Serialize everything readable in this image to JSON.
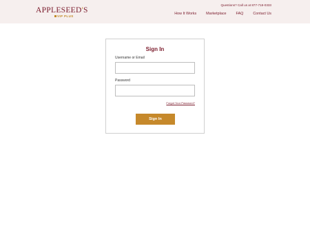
{
  "brand": {
    "name_part1": "APPLESEED",
    "name_apostrophe": "'",
    "name_part2": "S",
    "sub": "VIP PLUS"
  },
  "header": {
    "contact": "Questions? Call us at 877-718-0333",
    "nav": [
      "How It Works",
      "Marketplace",
      "FAQ",
      "Contact Us"
    ]
  },
  "form": {
    "title": "Sign In",
    "username_label": "Username or Email",
    "username_value": "",
    "password_label": "Password",
    "password_value": "",
    "forgot_link": "Forgot Your Password?",
    "submit_label": "Sign In"
  }
}
